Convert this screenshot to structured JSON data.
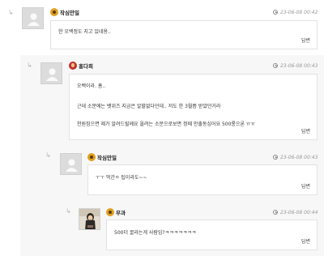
{
  "comments": [
    {
      "author": "작심만밀",
      "time": "23-06-08 00:42",
      "lines": [
        "한 오백정도 지고 있네용.."
      ],
      "reply_label": "답변"
    },
    {
      "author": "홍다희",
      "time": "23-06-08 00:43",
      "lines": [
        "오백이라. 흠..",
        "근데 소문에는 뱃위즈 지금은 알할없다던데.. 저도 한 3월쯤 받았던거라",
        "천원짐으면 제가 알려드릴께요 올려는 소문으로보면 정때 안출동심어요 500롱으론 ㅠㅠ"
      ],
      "reply_label": "답변"
    },
    {
      "author": "작심만밀",
      "time": "23-06-08 00:43",
      "lines": [
        "ㅜㅜ 먹간ㅇ 팁이라도~~"
      ],
      "reply_label": "답변"
    },
    {
      "author": "무과",
      "time": "23-06-08 00:44",
      "lines": [
        "500더 꿀라는게 사람임?ㅋㅋㅋㅋㅋㅋㅋ"
      ],
      "reply_label": "답변"
    }
  ],
  "reply_arrow": "↳"
}
